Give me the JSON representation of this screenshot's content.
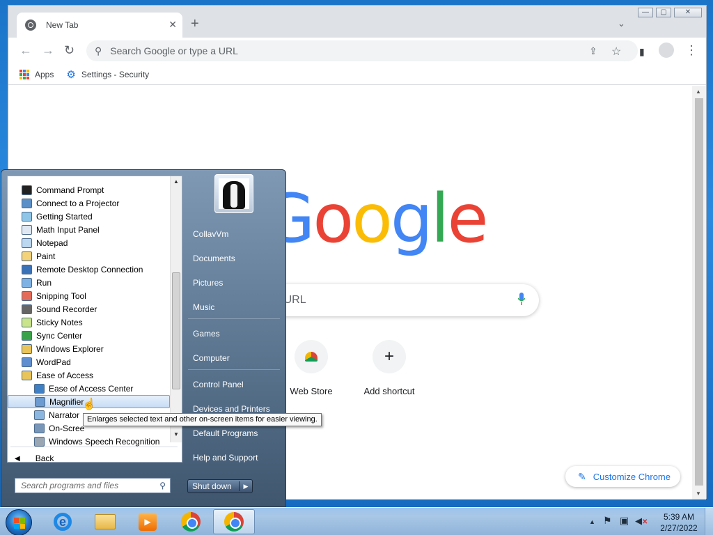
{
  "chrome": {
    "tab_title": "New Tab",
    "tab_close": "✕",
    "new_tab": "+",
    "tab_search": "⌄",
    "window_controls": {
      "minimize": "—",
      "maximize": "▢",
      "close": "✕"
    },
    "toolbar": {
      "back": "←",
      "forward": "→",
      "reload": "↻",
      "share": "⇪",
      "star": "☆",
      "side_panel": "▮",
      "menu": "⋮"
    },
    "omnibox_placeholder": "Search Google or type a URL",
    "bookmarks": [
      {
        "label": "Apps",
        "icon": "apps-grid-icon"
      },
      {
        "label": "Settings - Security",
        "icon": "gear-icon"
      }
    ],
    "ntp": {
      "logo": [
        "G",
        "o",
        "o",
        "g",
        "l",
        "e"
      ],
      "logo_colors": [
        "#4285f4",
        "#ea4335",
        "#fbbc05",
        "#4285f4",
        "#34a853",
        "#ea4335"
      ],
      "search_placeholder": "ype a URL",
      "shortcuts": [
        {
          "label": "Web Store",
          "icon": "chrome-web-store-icon"
        },
        {
          "label": "Add shortcut",
          "icon": "+"
        }
      ],
      "customize_label": "Customize Chrome",
      "customize_icon": "✎"
    }
  },
  "start_menu": {
    "programs": [
      {
        "label": "Command Prompt",
        "icon": "cmd-icon",
        "color": "#222222"
      },
      {
        "label": "Connect to a Projector",
        "icon": "projector-icon",
        "color": "#5a8fc8"
      },
      {
        "label": "Getting Started",
        "icon": "getting-started-icon",
        "color": "#8fc6e8"
      },
      {
        "label": "Math Input Panel",
        "icon": "math-input-icon",
        "color": "#dfe8f2"
      },
      {
        "label": "Notepad",
        "icon": "notepad-icon",
        "color": "#bcd7f0"
      },
      {
        "label": "Paint",
        "icon": "paint-icon",
        "color": "#f4d27a"
      },
      {
        "label": "Remote Desktop Connection",
        "icon": "remote-desktop-icon",
        "color": "#3a72b8"
      },
      {
        "label": "Run",
        "icon": "run-icon",
        "color": "#7fb2e4"
      },
      {
        "label": "Snipping Tool",
        "icon": "scissors-icon",
        "color": "#e36b5a"
      },
      {
        "label": "Sound Recorder",
        "icon": "microphone-icon",
        "color": "#666666"
      },
      {
        "label": "Sticky Notes",
        "icon": "sticky-notes-icon",
        "color": "#c9e48a"
      },
      {
        "label": "Sync Center",
        "icon": "sync-icon",
        "color": "#3aa34a"
      },
      {
        "label": "Windows Explorer",
        "icon": "folder-icon",
        "color": "#e9c45a"
      },
      {
        "label": "WordPad",
        "icon": "wordpad-icon",
        "color": "#5f8fd0"
      },
      {
        "label": "Ease of Access",
        "icon": "folder-icon",
        "color": "#e9c45a"
      }
    ],
    "subprograms": [
      {
        "label": "Ease of Access Center",
        "icon": "ease-of-access-icon",
        "color": "#3f7fc4"
      },
      {
        "label": "Magnifier",
        "icon": "magnifier-icon",
        "color": "#6b9bd1",
        "selected": true
      },
      {
        "label": "Narrator",
        "icon": "narrator-icon",
        "color": "#8bb6e0"
      },
      {
        "label": "On-Scree",
        "icon": "keyboard-icon",
        "color": "#7796b8"
      },
      {
        "label": "Windows Speech Recognition",
        "icon": "microphone-icon",
        "color": "#9aa6b2"
      }
    ],
    "back_label": "Back",
    "search_placeholder": "Search programs and files",
    "search_icon": "⚲",
    "right_items": [
      "CollavVm",
      "Documents",
      "Pictures",
      "Music",
      "Games",
      "Computer",
      "Control Panel",
      "Devices and Printers",
      "Default Programs",
      "Help and Support"
    ],
    "shutdown_label": "Shut down",
    "shutdown_arrow": "▶",
    "tooltip": "Enlarges selected text and other on-screen items for easier viewing."
  },
  "taskbar": {
    "apps": [
      {
        "name": "internet-explorer",
        "glyph": "e"
      },
      {
        "name": "windows-explorer"
      },
      {
        "name": "media-player",
        "glyph": "▶"
      },
      {
        "name": "chrome"
      },
      {
        "name": "chrome-active"
      }
    ],
    "tray": {
      "show_hidden": "▲",
      "flag": "⚑",
      "network": "▣",
      "volume_muted": "✕"
    },
    "time": "5:39 AM",
    "date": "2/27/2022"
  }
}
